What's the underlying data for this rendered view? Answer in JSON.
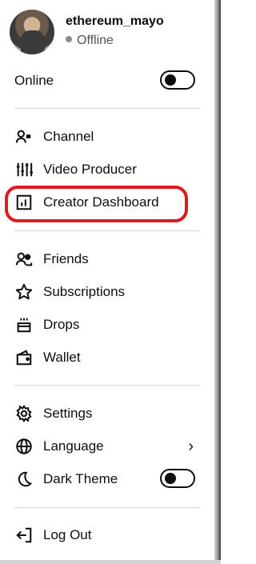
{
  "profile": {
    "username": "ethereum_mayo",
    "status": "Offline"
  },
  "online": {
    "label": "Online",
    "enabled": false
  },
  "menu_group_1": [
    {
      "label": "Channel",
      "icon": "channel-icon"
    },
    {
      "label": "Video Producer",
      "icon": "video-producer-icon"
    },
    {
      "label": "Creator Dashboard",
      "icon": "dashboard-icon",
      "highlighted": true
    }
  ],
  "menu_group_2": [
    {
      "label": "Friends",
      "icon": "friends-icon"
    },
    {
      "label": "Subscriptions",
      "icon": "star-icon"
    },
    {
      "label": "Drops",
      "icon": "drops-icon"
    },
    {
      "label": "Wallet",
      "icon": "wallet-icon"
    }
  ],
  "menu_group_3": [
    {
      "label": "Settings",
      "icon": "gear-icon"
    },
    {
      "label": "Language",
      "icon": "globe-icon",
      "has_submenu": true
    },
    {
      "label": "Dark Theme",
      "icon": "moon-icon",
      "toggle_enabled": false
    }
  ],
  "logout": {
    "label": "Log Out",
    "icon": "logout-icon"
  },
  "colors": {
    "highlight": "#e01b1b",
    "text": "#0e0e10",
    "muted": "#53535f"
  }
}
